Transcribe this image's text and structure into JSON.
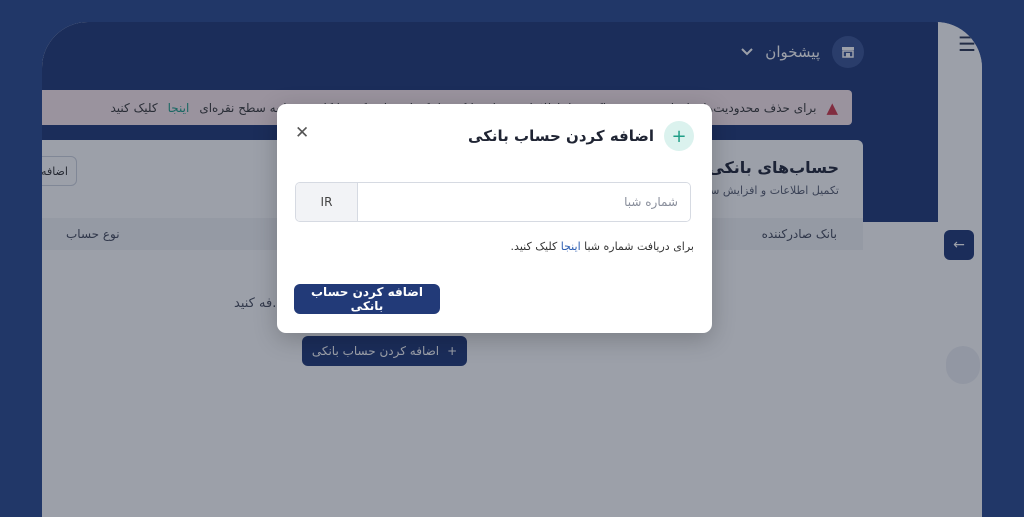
{
  "header": {
    "brand_label": "پیشخوان",
    "brand_icon": "store-icon",
    "dropdown_icon": "chevron-down-icon",
    "menu_icon": "hamburger-menu-icon"
  },
  "alert": {
    "icon": "warning-icon",
    "text_before": "برای حذف محدودیت‌ها و افزایش سقف تراکنش‌ها، اطلاعات حساب بانکی را تکمیل و تایید کنید تا کاربر شما به سطح نقره‌ای",
    "link_text": "اینجا",
    "text_after": "کلیک کنید"
  },
  "card": {
    "title": "حساب‌های بانکی",
    "subtitle": "تکمیل اطلاعات و افزایش سطح",
    "side_button": "اضافه",
    "columns": {
      "issuer_bank": "بانک صادرکننده",
      "account_type": "نوع حساب"
    },
    "empty_text": "فه کنید.",
    "add_button": "اضافه کردن حساب بانکی"
  },
  "modal": {
    "title": "اضافه کردن حساب بانکی",
    "close_icon": "close-icon",
    "iban_prefix": "IR",
    "iban_placeholder": "شماره شبا",
    "helper_before": "برای دریافت شماره شبا",
    "helper_link": "اینجا",
    "helper_after": "کلیک کنید.",
    "submit_button": "اضافه کردن حساب بانکی"
  },
  "colors": {
    "primary": "#223a78",
    "accent": "#1f9e87",
    "alert_bg": "#fbe9ec",
    "alert_icon": "#d13a4a"
  }
}
